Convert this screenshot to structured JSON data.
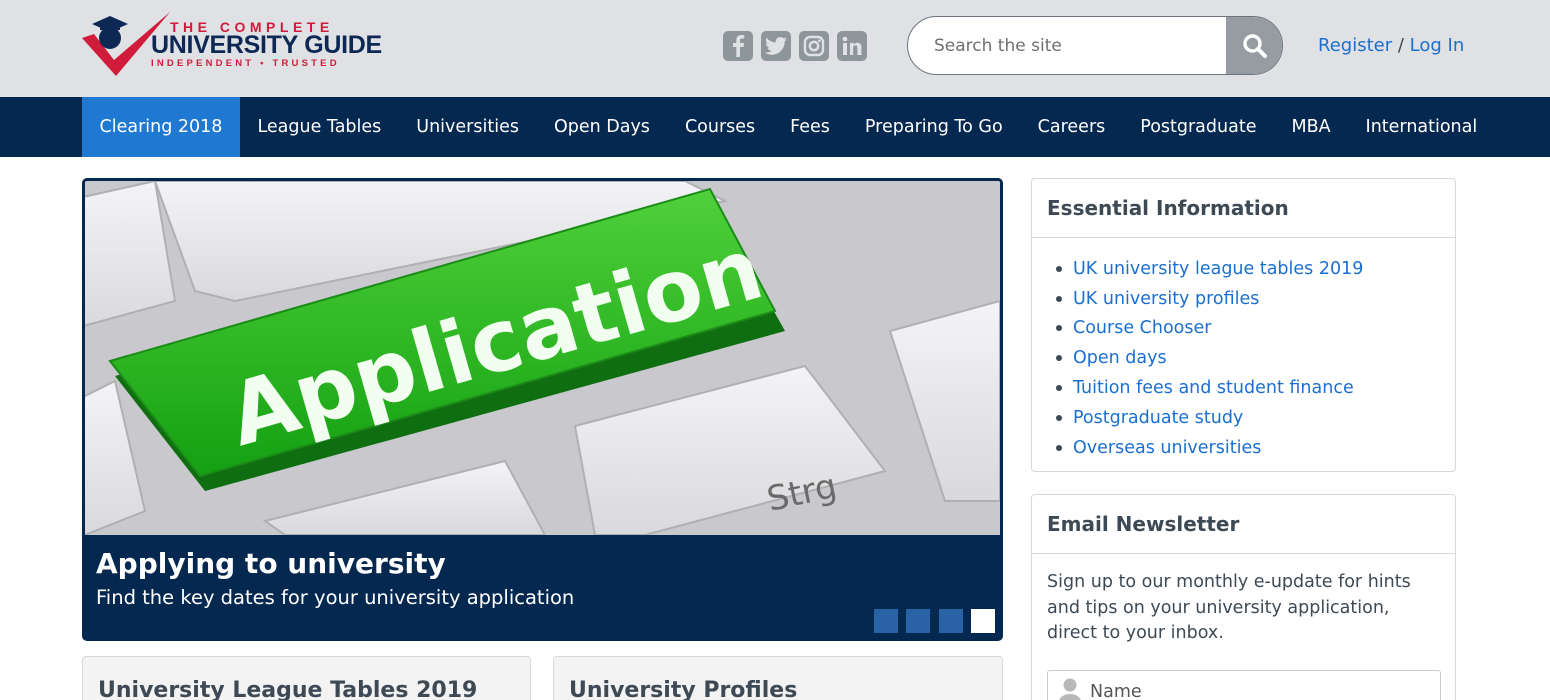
{
  "header": {
    "logo": {
      "line1": "THE COMPLETE",
      "line2": "UNIVERSITY GUIDE",
      "line3": "INDEPENDENT • TRUSTED"
    },
    "social_icons": [
      "facebook-icon",
      "twitter-icon",
      "instagram-icon",
      "linkedin-icon"
    ],
    "search": {
      "placeholder": "Search the site"
    },
    "auth": {
      "register_label": "Register",
      "separator": "/",
      "login_label": "Log In"
    }
  },
  "nav": {
    "items": [
      {
        "label": "Clearing 2018",
        "active": true
      },
      {
        "label": "League Tables",
        "active": false
      },
      {
        "label": "Universities",
        "active": false
      },
      {
        "label": "Open Days",
        "active": false
      },
      {
        "label": "Courses",
        "active": false
      },
      {
        "label": "Fees",
        "active": false
      },
      {
        "label": "Preparing To Go",
        "active": false
      },
      {
        "label": "Careers",
        "active": false
      },
      {
        "label": "Postgraduate",
        "active": false
      },
      {
        "label": "MBA",
        "active": false
      },
      {
        "label": "International",
        "active": false
      }
    ]
  },
  "carousel": {
    "image_key_label": "Application",
    "image_side_key": "Strg",
    "caption_title": "Applying to university",
    "caption_subtitle": "Find the key dates for your university application",
    "slide_count": 4,
    "active_slide": 4
  },
  "essential": {
    "title": "Essential Information",
    "links": [
      "UK university league tables 2019",
      "UK university profiles",
      "Course Chooser",
      "Open days",
      "Tuition fees and student finance",
      "Postgraduate study",
      "Overseas universities"
    ]
  },
  "newsletter": {
    "title": "Email Newsletter",
    "text": "Sign up to our monthly e-update for hints and tips on your university application, direct to your inbox.",
    "name_placeholder": "Name"
  },
  "bottom_cards": {
    "left_title": "University League Tables 2019",
    "right_title": "University Profiles"
  },
  "colors": {
    "nav_bg": "#052850",
    "nav_active": "#1f79d3",
    "link": "#1b6fd1",
    "header_bg": "#dfe1e4",
    "brand_red": "#d01c3a"
  }
}
